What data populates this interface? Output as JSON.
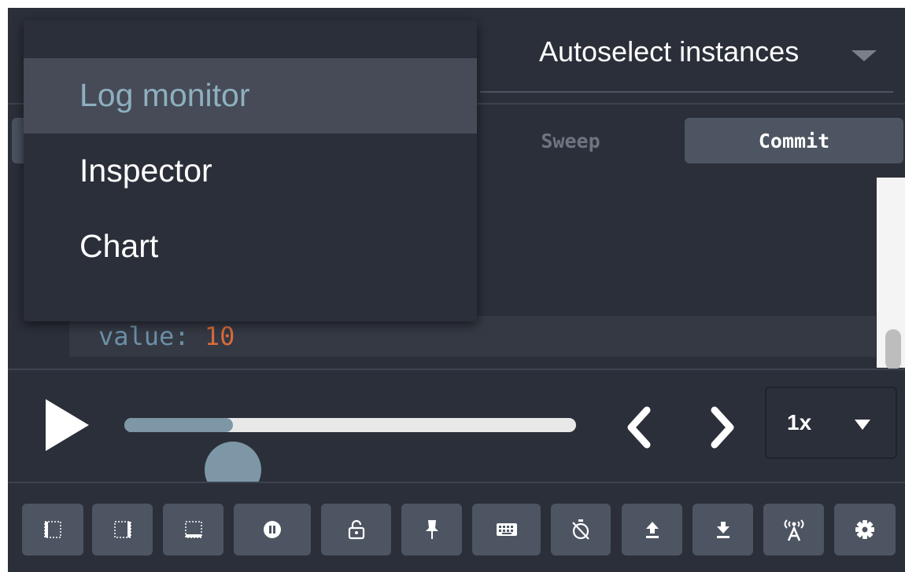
{
  "header": {
    "instances_label": "Autoselect instances"
  },
  "tabs": {
    "sweep_label": "Sweep",
    "commit_label": "Commit"
  },
  "content": {
    "value_key": "value:",
    "value_number": "10"
  },
  "player": {
    "progress": 0.24,
    "speed_label": "1x"
  },
  "menu": {
    "items": [
      {
        "label": "Log monitor",
        "selected": true
      },
      {
        "label": "Inspector",
        "selected": false
      },
      {
        "label": "Chart",
        "selected": false
      }
    ]
  },
  "toolbar": {
    "buttons": [
      "dock-left-icon",
      "dock-right-icon",
      "dock-bottom-icon",
      "pause-icon",
      "lock-icon",
      "pin-icon",
      "keyboard-icon",
      "timer-off-icon",
      "upload-icon",
      "download-icon",
      "remote-icon",
      "settings-icon"
    ]
  },
  "colors": {
    "background": "#2b2f39",
    "button": "#4d5562",
    "menu_highlight": "#464b57",
    "accent": "#7d97a6",
    "value_number": "#d96a3a",
    "value_key": "#6c8fa8"
  }
}
